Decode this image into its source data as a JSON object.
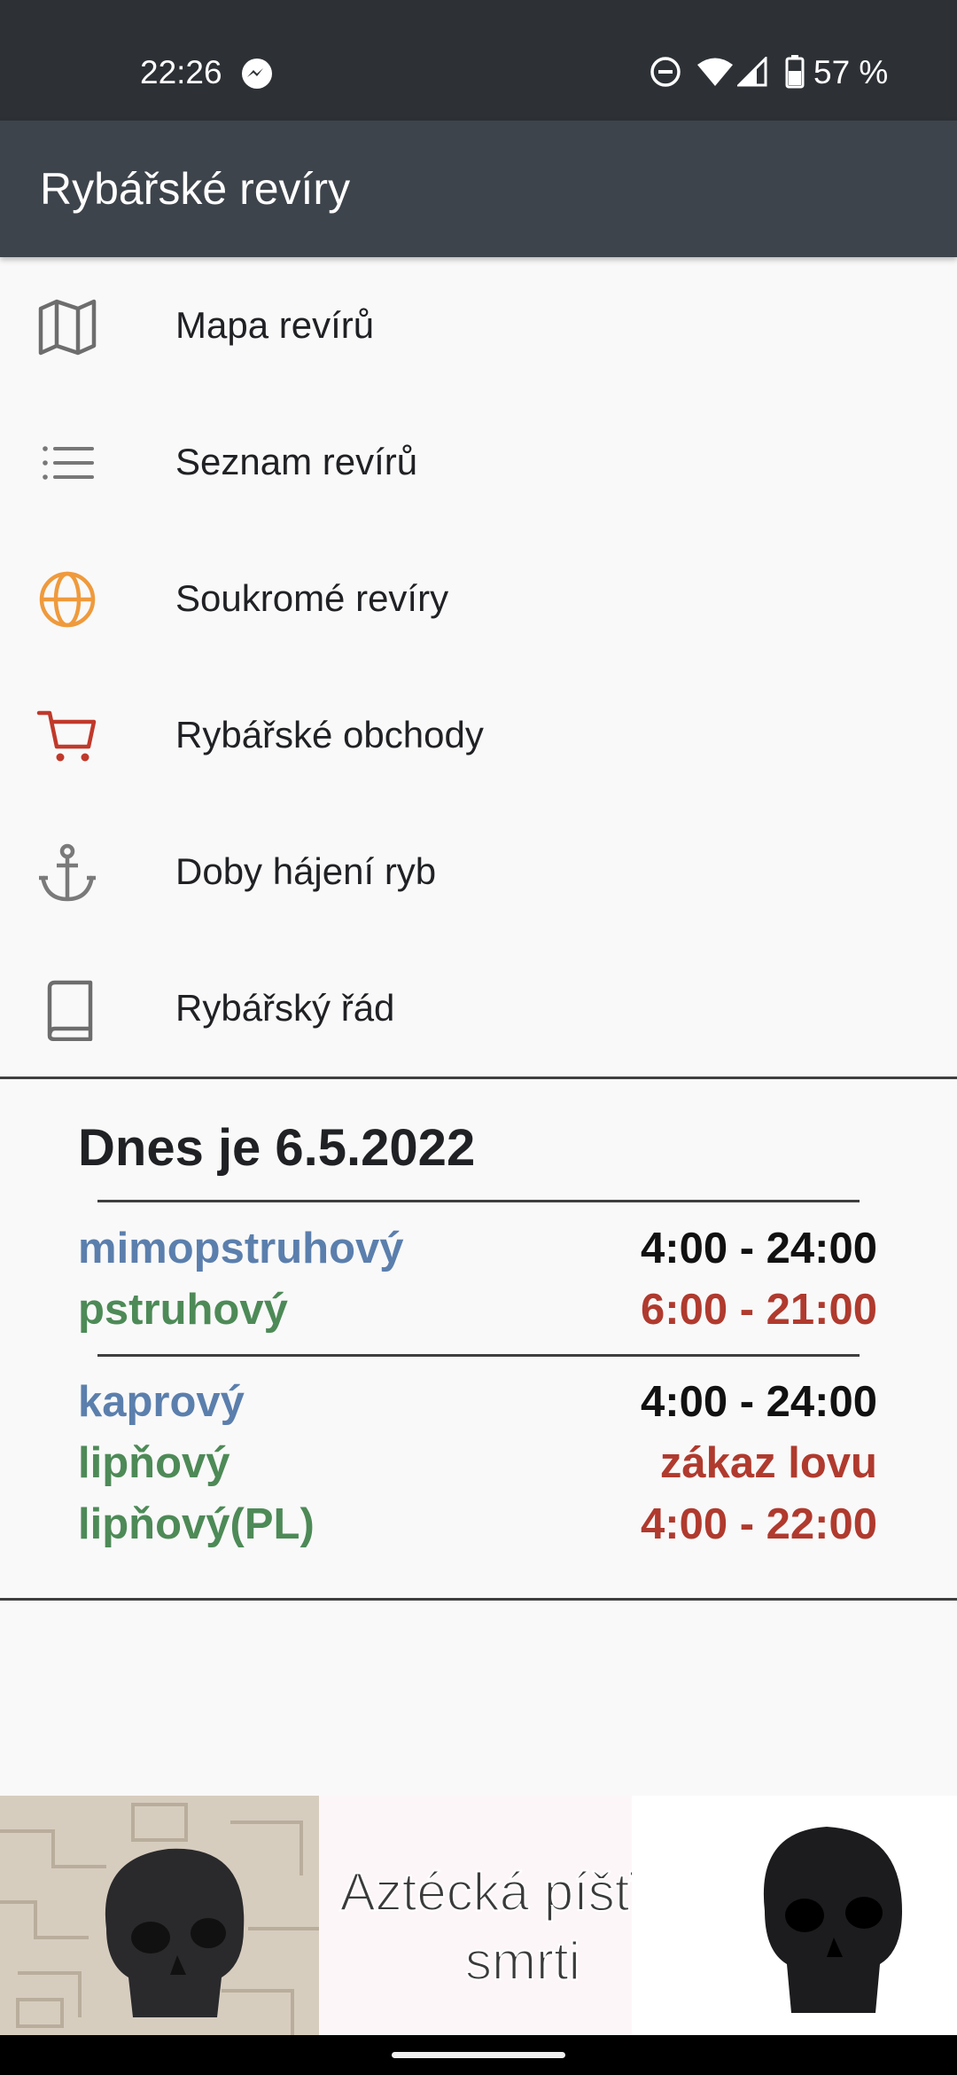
{
  "status_bar": {
    "time": "22:26",
    "battery": "57 %",
    "icons": [
      "messenger-icon",
      "dnd-icon",
      "wifi-icon",
      "signal-icon",
      "battery-icon"
    ]
  },
  "app_bar": {
    "title": "Rybářské revíry"
  },
  "menu": {
    "items": [
      {
        "label": "Mapa revírů",
        "icon": "map-icon"
      },
      {
        "label": "Seznam revírů",
        "icon": "list-icon"
      },
      {
        "label": "Soukromé revíry",
        "icon": "globe-icon"
      },
      {
        "label": "Rybářské obchody",
        "icon": "cart-icon"
      },
      {
        "label": "Doby hájení ryb",
        "icon": "anchor-icon"
      },
      {
        "label": "Rybářský řád",
        "icon": "book-icon"
      }
    ]
  },
  "today": {
    "title": "Dnes je 6.5.2022",
    "group1": [
      {
        "label": "mimopstruhový",
        "value": "4:00 - 24:00"
      },
      {
        "label": "pstruhový",
        "value": "6:00 - 21:00"
      }
    ],
    "group2": [
      {
        "label": "kaprový",
        "value": "4:00 - 24:00"
      },
      {
        "label": "lipňový",
        "value": "zákaz lovu"
      },
      {
        "label": "lipňový(PL)",
        "value": "4:00 - 22:00"
      }
    ]
  },
  "ad": {
    "line1": "Aztécká píšťala",
    "line2": "smrti"
  },
  "colors": {
    "status_bg": "#2d3136",
    "app_bar_bg": "#3e444b",
    "blue_label": "#5b7fad",
    "green_label": "#4d8a57",
    "red_value": "#b03a2e",
    "black_value": "#111111",
    "globe": "#ef9a3c",
    "cart": "#c0392b"
  }
}
